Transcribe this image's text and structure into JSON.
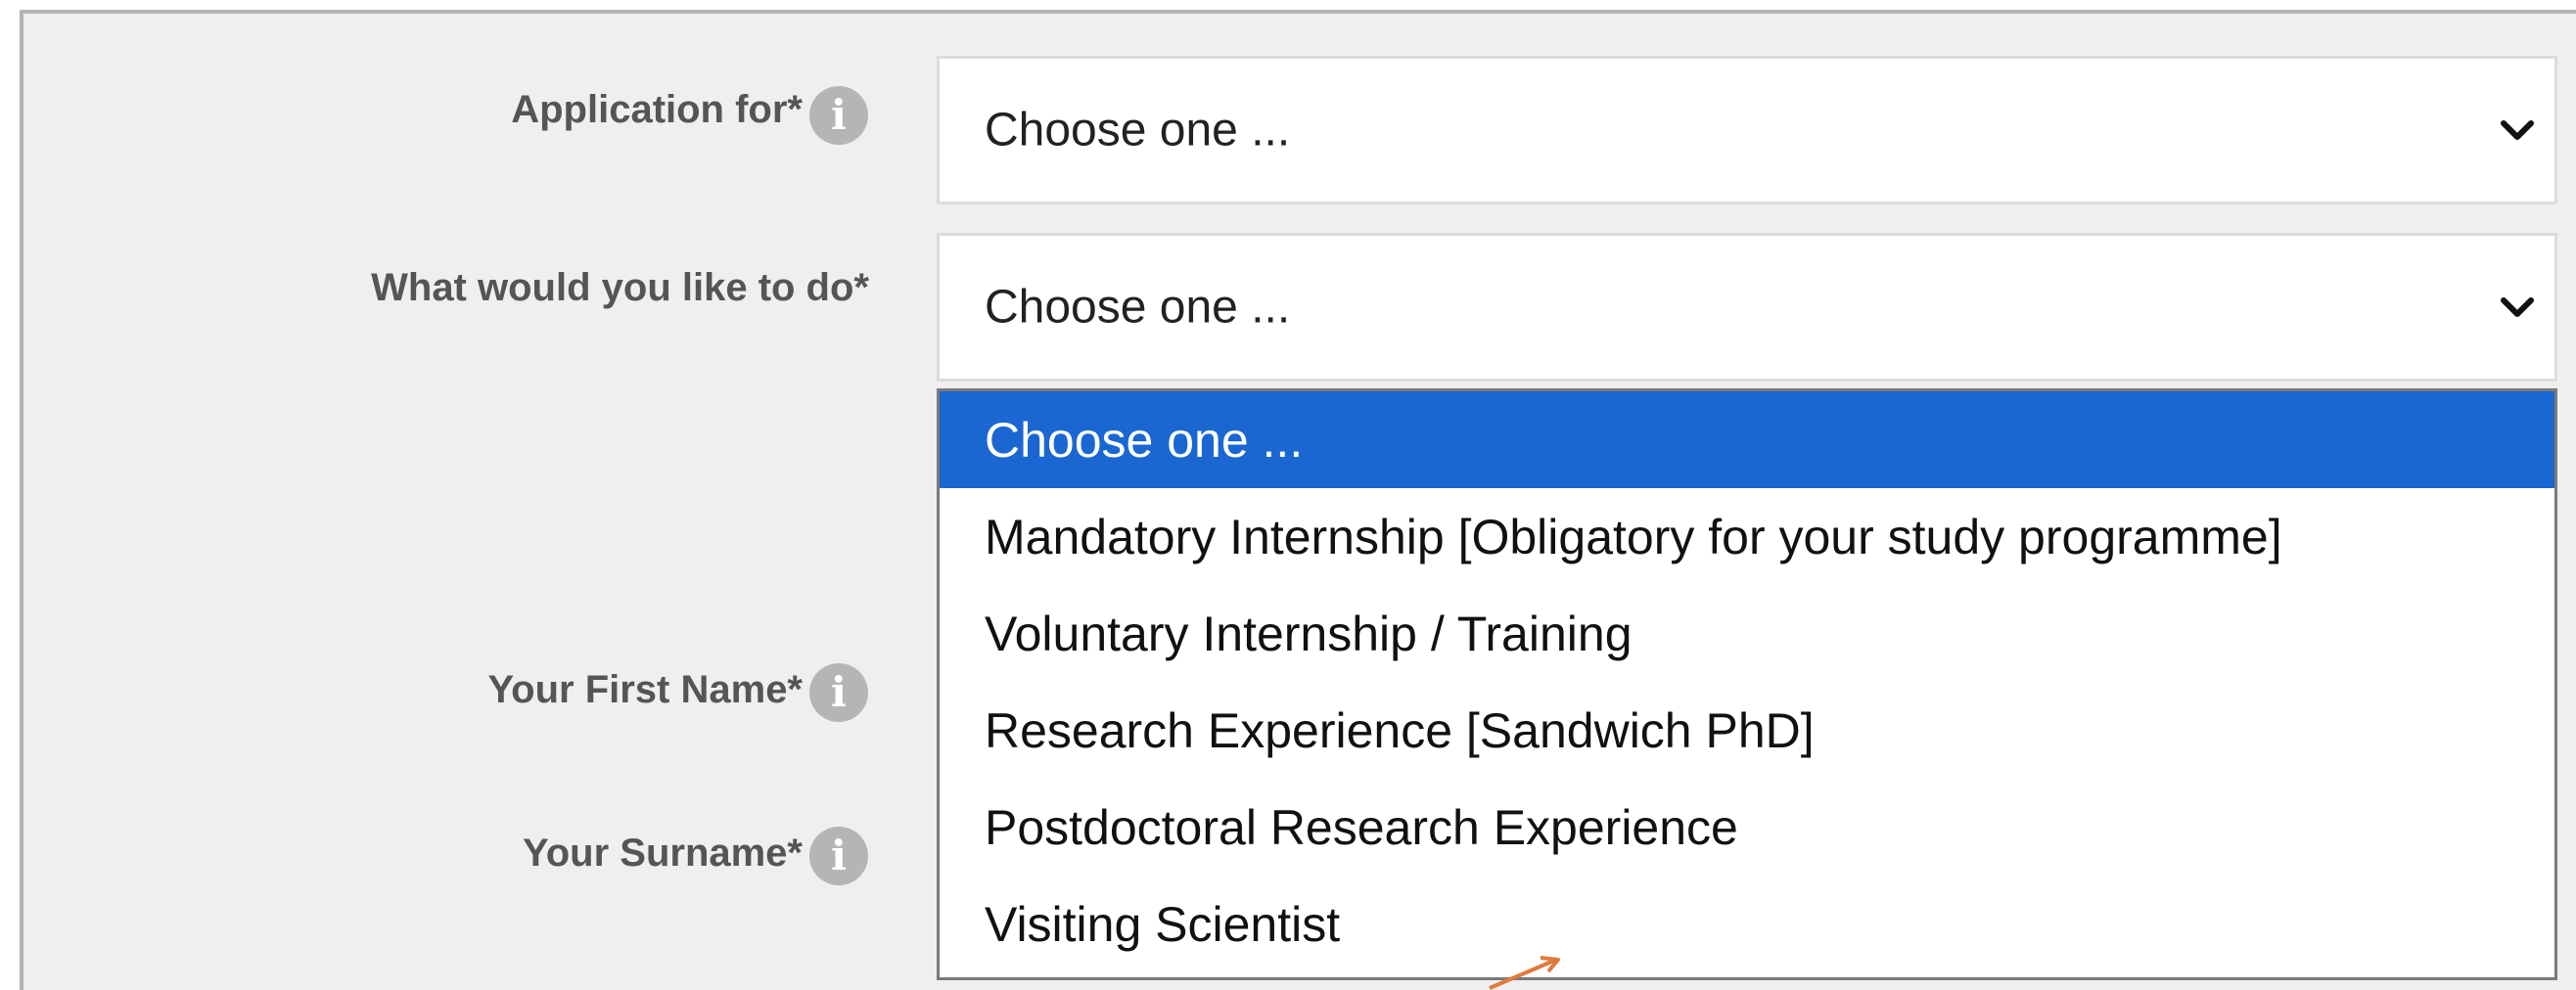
{
  "form": {
    "application_for": {
      "label": "Application for*",
      "value": "Choose one ..."
    },
    "what_to_do": {
      "label": "What would you like to do*",
      "value": "Choose one ...",
      "options": [
        "Choose one ...",
        "Mandatory Internship [Obligatory for your study programme]",
        "Voluntary Internship / Training",
        "Research Experience [Sandwich PhD]",
        "Postdoctoral Research Experience",
        "Visiting Scientist"
      ],
      "highlighted_index": 0
    },
    "first_name": {
      "label": "Your First Name*"
    },
    "surname": {
      "label": "Your Surname*"
    }
  },
  "icons": {
    "info": "i",
    "chevron": "chevron-down-icon"
  },
  "colors": {
    "background": "#efefef",
    "highlight": "#1a67d2",
    "info_icon": "#b5b5b5",
    "annotation_arrow": "#e07a3a"
  }
}
